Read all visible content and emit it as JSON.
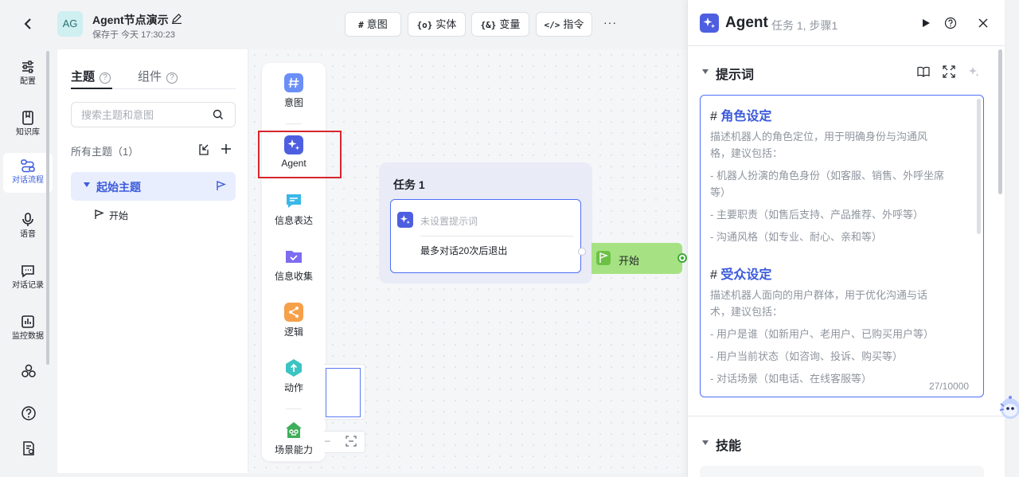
{
  "header": {
    "avatar": "AG",
    "title": "Agent节点演示",
    "saved": "保存于 今天 17:30:23",
    "toolbar": [
      {
        "glyph": "#",
        "label": "意图"
      },
      {
        "glyph": "{o}",
        "label": "实体"
      },
      {
        "glyph": "{&}",
        "label": "变量"
      },
      {
        "glyph": "</>",
        "label": "指令"
      }
    ],
    "more": "···"
  },
  "rail": [
    {
      "label": "配置",
      "icon": "sliders-icon"
    },
    {
      "label": "知识库",
      "icon": "book-icon"
    },
    {
      "label": "对话流程",
      "icon": "flow-icon",
      "active": true
    },
    {
      "label": "语音",
      "icon": "microphone-icon"
    },
    {
      "label": "对话记录",
      "icon": "chat-icon"
    },
    {
      "label": "监控数据",
      "icon": "chart-icon"
    }
  ],
  "topics": {
    "tabs": [
      {
        "label": "主题"
      },
      {
        "label": "组件"
      }
    ],
    "search_placeholder": "搜索主题和意图",
    "all_label": "所有主题（1）",
    "items": [
      {
        "name": "起始主题",
        "children": [
          "开始"
        ]
      }
    ]
  },
  "palette": [
    {
      "label": "意图",
      "icon": "intent-icon"
    },
    {
      "label": "Agent",
      "icon": "agent-sparkle-icon"
    },
    {
      "label": "信息表达",
      "icon": "message-icon"
    },
    {
      "label": "信息收集",
      "icon": "folder-check-icon"
    },
    {
      "label": "逻辑",
      "icon": "logic-icon"
    },
    {
      "label": "动作",
      "icon": "action-icon"
    },
    {
      "label": "场景能力",
      "icon": "scene-icon"
    }
  ],
  "canvas": {
    "zoom_minus": "–",
    "task": {
      "title": "任务 1",
      "prompt_placeholder": "未设置提示词",
      "exit_rule": "最多对话20次后退出"
    },
    "start_node": {
      "label": "开始"
    }
  },
  "agent_panel": {
    "title": "Agent",
    "subtitle": "任务 1, 步骤1",
    "prompt_section": "提示词",
    "skills_section": "技能",
    "editor": {
      "role_heading": "角色设定",
      "role_desc": [
        "描述机器人的角色定位，用于明确身份与沟通风",
        "格，建议包括："
      ],
      "role_points": [
        "- 机器人扮演的角色身份（如客服、销售、外呼坐席",
        "等）",
        "- 主要职责（如售后支持、产品推荐、外呼等）",
        "- 沟通风格（如专业、耐心、亲和等）"
      ],
      "audience_heading": "受众设定",
      "audience_desc": [
        "描述机器人面向的用户群体，用于优化沟通与话",
        "术，建议包括："
      ],
      "audience_points": [
        "- 用户是谁（如新用户、老用户、已购买用户等）",
        "- 用户当前状态（如咨询、投诉、购买等）",
        "- 对话场景（如电话、在线客服等）"
      ],
      "count": "27/10000"
    }
  },
  "colors": {
    "accent": "#3b5bdb",
    "highlight_box": "#d7262d",
    "start_node": "#a6e283"
  }
}
